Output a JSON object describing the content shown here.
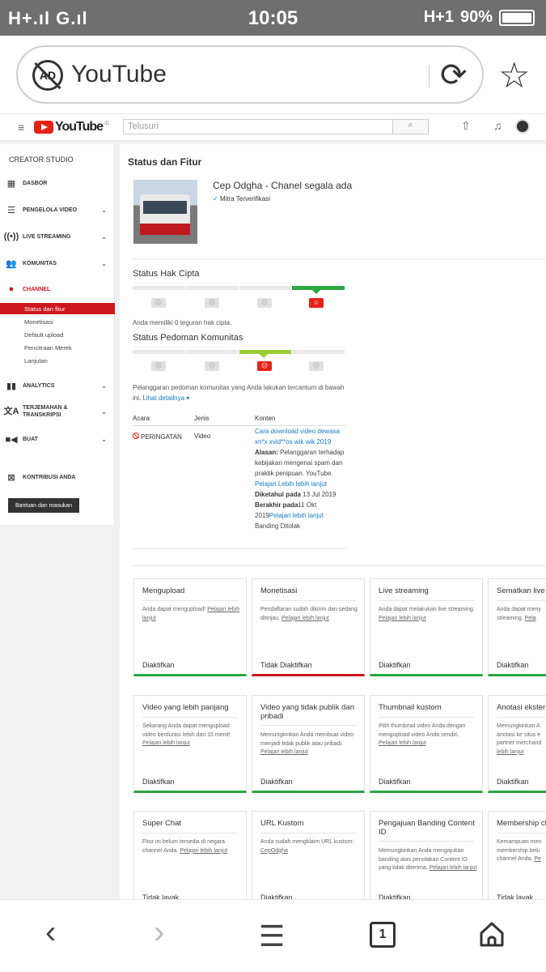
{
  "status_bar": {
    "signal_left": "H+.ıl G.ıl",
    "time": "10:05",
    "network": "H+1",
    "battery": "90%"
  },
  "browser": {
    "url_title": "YouTube",
    "ad_label": "AD"
  },
  "yt_header": {
    "brand": "YouTube",
    "region": "ID",
    "search_placeholder": "Telusuri"
  },
  "sidebar": {
    "title": "CREATOR STUDIO",
    "items": [
      {
        "label": "DASBOR"
      },
      {
        "label": "PENGELOLA VIDEO"
      },
      {
        "label": "LIVE STREAMING"
      },
      {
        "label": "KOMUNITAS"
      },
      {
        "label": "CHANNEL"
      },
      {
        "label": "ANALYTICS"
      },
      {
        "label": "TERJEMAHAN & TRANSKRIPSI"
      },
      {
        "label": "BUAT"
      },
      {
        "label": "KONTRIBUSI ANDA"
      }
    ],
    "subitems": [
      "Status dan fitur",
      "Monetisasi",
      "Default upload",
      "Pencitraan Merek",
      "Lanjutan"
    ],
    "help_button": "Bantuan dan masukan"
  },
  "main": {
    "title": "Status dan Fitur",
    "channel_name": "Cep Odgha - Chanel segala ada",
    "verified": "Mitra Terverifikasi",
    "copyright_title": "Status Hak Cipta",
    "copyright_note": "Anda memiliki 0 teguran hak cipta.",
    "community_title": "Status Pedoman Komunitas",
    "community_note": "Pelanggaran pedoman komunitas yang Anda lakukan tercantum di bawah ini.",
    "see_details": "Lihat detailnya ▾",
    "table_headers": [
      "Acara",
      "Jenis",
      "Konten"
    ],
    "row": {
      "event": "PERINGATAN",
      "type": "Video",
      "video_link": "Cara download video dewasa xn*x xvid**os wik wik 2019",
      "reason_label": "Alasan:",
      "reason_text": "Pelanggaran terhadap kebijakan mengenai spam dan praktik penipuan. YouTube.",
      "learn_more": "Pelajari Lebih lebih lanjut",
      "known_label": "Diketahui pada",
      "known_date": "13 Jul 2019",
      "ends_label": "Berakhir pada",
      "ends_date": "11 Okt 2019",
      "learn_more2": "Pelajari lebih lanjut",
      "appeal": "Banding Ditolak"
    }
  },
  "cards": [
    {
      "title": "Mengupload",
      "desc": "Anda dapat mengupload!",
      "link": "Pelajari lebih lanjut",
      "status": "Diaktifkan"
    },
    {
      "title": "Monetisasi",
      "desc": "Pendaftaran sudah dikirim dan sedang ditinjau.",
      "link": "Pelajari lebih lanjut",
      "status": "Tidak Diaktifkan"
    },
    {
      "title": "Live streaming",
      "desc": "Anda dapat melakukan live streaming.",
      "link": "Pelajari lebih lanjut",
      "status": "Diaktifkan"
    },
    {
      "title": "Sematkan live",
      "desc": "Anda dapat meny streaming.",
      "link": "Pela",
      "status": "Diaktifkan"
    },
    {
      "title": "Video yang lebih panjang",
      "desc": "Sekarang Anda dapat mengupload video berdurasi lebih dari 15 menit!",
      "link": "Pelajari lebih lanjut",
      "status": "Diaktifkan"
    },
    {
      "title": "Video yang tidak publik dan pribadi",
      "desc": "Memungkinkan Anda membuat video menjadi tidak publik atau pribadi.",
      "link": "Pelajari lebih lanjut",
      "status": "Diaktifkan"
    },
    {
      "title": "Thumbnail kustom",
      "desc": "Pilih thumbnail video Anda dengan mengupload video Anda sendiri.",
      "link": "Pelajari lebih lanjut",
      "status": "Diaktifkan"
    },
    {
      "title": "Anotasi ekstern",
      "desc": "Memungkinkan A anotasi ke situs e partner merchand",
      "link": "lebih lanjut",
      "status": "Diaktifkan"
    },
    {
      "title": "Super Chat",
      "desc": "Fitur ini belum tersedia di negara channel Anda.",
      "link": "Pelajari lebih lanjut",
      "status": "Tidak layak"
    },
    {
      "title": "URL Kustom",
      "desc": "Anda sudah mengklaim URL kustom:",
      "link": "CepOdgha",
      "status": "Diaktifkan"
    },
    {
      "title": "Pengajuan Banding Content ID",
      "desc": "Memungkinkan Anda mengajukan banding atas penolakan Content ID yang tidak diterima.",
      "link": "Pelajari lebih lanjut",
      "status": "Diaktifkan"
    },
    {
      "title": "Membership ch",
      "desc": "Kemampuan men membership belu channel Anda.",
      "link": "Pe",
      "status": "Tidak layak"
    }
  ],
  "nav": {
    "tab_count": "1"
  },
  "colors": {
    "accent_red": "#e62117",
    "active_red": "#cc181e",
    "green": "#2ba640",
    "link_blue": "#167ac6",
    "community_meter": "#9acd32"
  }
}
